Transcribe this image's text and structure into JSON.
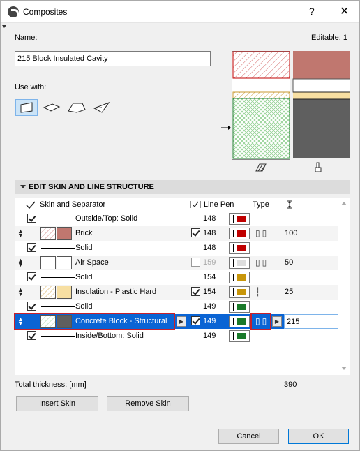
{
  "window": {
    "title": "Composites",
    "help": "?",
    "close": "✕"
  },
  "name_label": "Name:",
  "editable": "Editable: 1",
  "name_value": "215 Block Insulated Cavity",
  "use_with_label": "Use with:",
  "section_title": "EDIT SKIN AND LINE STRUCTURE",
  "columns": {
    "skin": "Skin and Separator",
    "line_pen": "Line Pen",
    "type": "Type"
  },
  "rows": [
    {
      "kind": "separator",
      "label": "Outside/Top: Solid",
      "pen": "148",
      "pen_color": "#c00000"
    },
    {
      "kind": "skin",
      "label": "Brick",
      "pen": "148",
      "pen_color": "#c00000",
      "thickness": "100",
      "fill": "#c0776f",
      "hatch": "#d08080",
      "checked": true
    },
    {
      "kind": "separator",
      "label": "Solid",
      "pen": "148",
      "pen_color": "#c00000"
    },
    {
      "kind": "skin",
      "label": "Air Space",
      "pen": "159",
      "pen_color": "#dddddd",
      "thickness": "50",
      "fill": "#ffffff",
      "hatch": "#ffffff",
      "checked": false
    },
    {
      "kind": "separator",
      "label": "Solid",
      "pen": "154",
      "pen_color": "#c8960a"
    },
    {
      "kind": "skin",
      "label": "Insulation - Plastic Hard",
      "pen": "154",
      "pen_color": "#c8960a",
      "thickness": "25",
      "fill": "#f7dfa2",
      "hatch": "#d8b060",
      "checked": true
    },
    {
      "kind": "separator",
      "label": "Solid",
      "pen": "149",
      "pen_color": "#1a7a2a"
    },
    {
      "kind": "skin",
      "label": "Concrete Block - Structural",
      "pen": "149",
      "pen_color": "#1a7a2a",
      "thickness": "215",
      "fill": "#5f5f5f",
      "hatch": "#9fd89f",
      "checked": true,
      "selected": true
    },
    {
      "kind": "separator",
      "label": "Inside/Bottom: Solid",
      "pen": "149",
      "pen_color": "#1a7a2a"
    }
  ],
  "total_label": "Total thickness: [mm]",
  "total_value": "390",
  "buttons": {
    "insert_skin": "Insert Skin",
    "remove_skin": "Remove Skin",
    "cancel": "Cancel",
    "ok": "OK"
  }
}
